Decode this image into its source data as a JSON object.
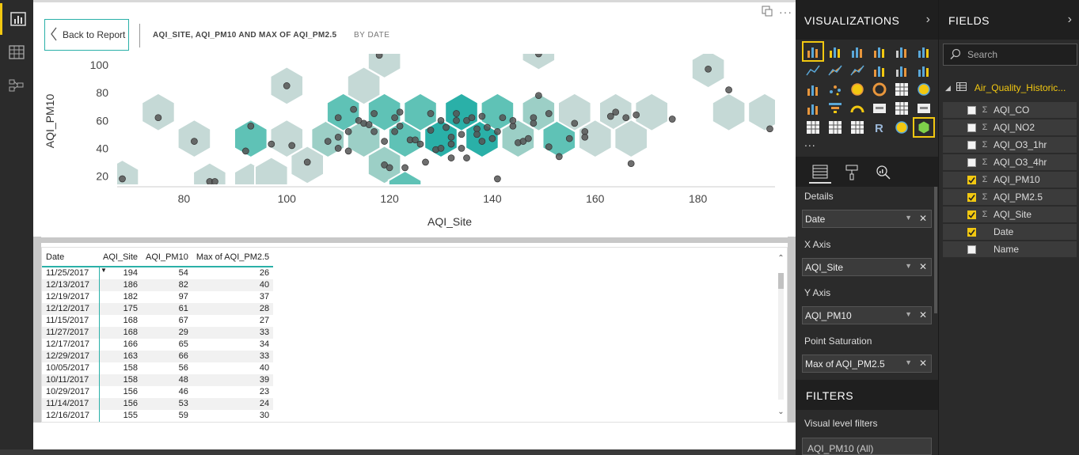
{
  "canvas": {
    "back_button": "Back to Report",
    "title": "AQI_SITE, AQI_PM10 AND MAX OF AQI_PM2.5",
    "subtitle": "BY DATE"
  },
  "chart_data": {
    "type": "scatter",
    "subtype": "hexbin",
    "xlabel": "AQI_Site",
    "ylabel": "AQI_PM10",
    "x_ticks": [
      "80",
      "100",
      "120",
      "140",
      "160",
      "180"
    ],
    "y_ticks": [
      "100",
      "80",
      "60",
      "40",
      "20"
    ],
    "xlim": [
      67,
      195
    ],
    "ylim": [
      14,
      108
    ],
    "hex_saturation_note": "hex color intensity = Max of AQI_PM2.5",
    "points": [
      [
        68,
        18
      ],
      [
        75,
        62
      ],
      [
        82,
        45
      ],
      [
        85,
        16
      ],
      [
        86,
        16
      ],
      [
        93,
        56
      ],
      [
        92,
        38
      ],
      [
        97,
        43
      ],
      [
        100,
        85
      ],
      [
        101,
        42
      ],
      [
        104,
        30
      ],
      [
        108,
        45
      ],
      [
        110,
        62
      ],
      [
        110,
        48
      ],
      [
        110,
        40
      ],
      [
        112,
        52
      ],
      [
        112,
        38
      ],
      [
        113,
        68
      ],
      [
        114,
        60
      ],
      [
        115,
        58
      ],
      [
        116,
        57
      ],
      [
        117,
        52
      ],
      [
        117,
        65
      ],
      [
        118,
        107
      ],
      [
        119,
        45
      ],
      [
        119,
        28
      ],
      [
        120,
        26
      ],
      [
        121,
        62
      ],
      [
        121,
        52
      ],
      [
        122,
        66
      ],
      [
        122,
        56
      ],
      [
        123,
        26
      ],
      [
        124,
        46
      ],
      [
        125,
        46
      ],
      [
        126,
        43
      ],
      [
        127,
        30
      ],
      [
        128,
        65
      ],
      [
        128,
        53
      ],
      [
        129,
        39
      ],
      [
        130,
        60
      ],
      [
        130,
        40
      ],
      [
        131,
        55
      ],
      [
        132,
        43
      ],
      [
        132,
        33
      ],
      [
        132,
        48
      ],
      [
        133,
        65
      ],
      [
        133,
        60
      ],
      [
        134,
        50
      ],
      [
        134,
        40
      ],
      [
        135,
        60
      ],
      [
        135,
        33
      ],
      [
        136,
        62
      ],
      [
        137,
        54
      ],
      [
        137,
        50
      ],
      [
        138,
        45
      ],
      [
        138,
        63
      ],
      [
        139,
        55
      ],
      [
        140,
        47
      ],
      [
        141,
        52
      ],
      [
        141,
        18
      ],
      [
        142,
        62
      ],
      [
        144,
        56
      ],
      [
        144,
        60
      ],
      [
        145,
        44
      ],
      [
        146,
        45
      ],
      [
        147,
        47
      ],
      [
        148,
        62
      ],
      [
        148,
        58
      ],
      [
        149,
        78
      ],
      [
        151,
        65
      ],
      [
        151,
        41
      ],
      [
        153,
        34
      ],
      [
        155,
        47
      ],
      [
        156,
        58
      ],
      [
        158,
        52
      ],
      [
        158,
        48
      ],
      [
        163,
        63
      ],
      [
        164,
        66
      ],
      [
        166,
        62
      ],
      [
        167,
        29
      ],
      [
        168,
        64
      ],
      [
        175,
        61
      ],
      [
        182,
        97
      ],
      [
        186,
        82
      ],
      [
        194,
        54
      ],
      [
        149,
        108
      ],
      [
        150,
        113
      ]
    ],
    "hexes": [
      {
        "x": 68,
        "y": 18,
        "level": 1
      },
      {
        "x": 75,
        "y": 66,
        "level": 1
      },
      {
        "x": 82,
        "y": 47,
        "level": 1
      },
      {
        "x": 85,
        "y": 16,
        "level": 1
      },
      {
        "x": 93,
        "y": 16,
        "level": 1
      },
      {
        "x": 93,
        "y": 47,
        "level": 3
      },
      {
        "x": 100,
        "y": 85,
        "level": 1
      },
      {
        "x": 100,
        "y": 47,
        "level": 1
      },
      {
        "x": 108,
        "y": 47,
        "level": 2
      },
      {
        "x": 104,
        "y": 28,
        "level": 1
      },
      {
        "x": 111,
        "y": 66,
        "level": 3
      },
      {
        "x": 115,
        "y": 47,
        "level": 2
      },
      {
        "x": 119,
        "y": 66,
        "level": 3
      },
      {
        "x": 119,
        "y": 28,
        "level": 2
      },
      {
        "x": 119,
        "y": 104,
        "level": 1
      },
      {
        "x": 115,
        "y": 85,
        "level": 1
      },
      {
        "x": 123,
        "y": 47,
        "level": 3
      },
      {
        "x": 126,
        "y": 66,
        "level": 3
      },
      {
        "x": 130,
        "y": 47,
        "level": 4
      },
      {
        "x": 134,
        "y": 66,
        "level": 4
      },
      {
        "x": 138,
        "y": 47,
        "level": 4
      },
      {
        "x": 141,
        "y": 66,
        "level": 3
      },
      {
        "x": 145,
        "y": 47,
        "level": 2
      },
      {
        "x": 149,
        "y": 66,
        "level": 2
      },
      {
        "x": 153,
        "y": 47,
        "level": 3
      },
      {
        "x": 156,
        "y": 66,
        "level": 1
      },
      {
        "x": 160,
        "y": 47,
        "level": 1
      },
      {
        "x": 164,
        "y": 66,
        "level": 1
      },
      {
        "x": 167,
        "y": 47,
        "level": 1
      },
      {
        "x": 171,
        "y": 66,
        "level": 1
      },
      {
        "x": 182,
        "y": 97,
        "level": 1
      },
      {
        "x": 186,
        "y": 66,
        "level": 1
      },
      {
        "x": 193,
        "y": 66,
        "level": 1
      },
      {
        "x": 149,
        "y": 110,
        "level": 1
      },
      {
        "x": 123,
        "y": 10,
        "level": 3
      },
      {
        "x": 97,
        "y": 20,
        "level": 1
      }
    ]
  },
  "table": {
    "columns": [
      "Date",
      "AQI_Site",
      "AQI_PM10",
      "Max of AQI_PM2.5"
    ],
    "sort_indicator": "▼",
    "rows": [
      [
        "11/25/2017",
        "194",
        "54",
        "26"
      ],
      [
        "12/13/2017",
        "186",
        "82",
        "40"
      ],
      [
        "12/19/2017",
        "182",
        "97",
        "37"
      ],
      [
        "12/12/2017",
        "175",
        "61",
        "28"
      ],
      [
        "11/15/2017",
        "168",
        "67",
        "27"
      ],
      [
        "11/27/2017",
        "168",
        "29",
        "33"
      ],
      [
        "12/17/2017",
        "166",
        "65",
        "34"
      ],
      [
        "12/29/2017",
        "163",
        "66",
        "33"
      ],
      [
        "10/05/2017",
        "158",
        "56",
        "40"
      ],
      [
        "10/11/2017",
        "158",
        "48",
        "39"
      ],
      [
        "10/29/2017",
        "156",
        "46",
        "23"
      ],
      [
        "11/14/2017",
        "156",
        "53",
        "24"
      ],
      [
        "12/16/2017",
        "155",
        "59",
        "30"
      ]
    ]
  },
  "visualizations": {
    "title": "VISUALIZATIONS",
    "more": "...",
    "wells": [
      {
        "label": "Details",
        "value": "Date"
      },
      {
        "label": "X Axis",
        "value": "AQI_Site"
      },
      {
        "label": "Y Axis",
        "value": "AQI_PM10"
      },
      {
        "label": "Point Saturation",
        "value": "Max of AQI_PM2.5"
      }
    ],
    "filters_title": "FILTERS",
    "visual_level_filters": "Visual level filters",
    "filter_item": "AQI_PM10 (All)"
  },
  "fields": {
    "title": "FIELDS",
    "search_placeholder": "Search",
    "table_name": "Air_Quality_Historic...",
    "items": [
      {
        "name": "AQI_CO",
        "checked": false,
        "sigma": true
      },
      {
        "name": "AQI_NO2",
        "checked": false,
        "sigma": true
      },
      {
        "name": "AQI_O3_1hr",
        "checked": false,
        "sigma": true
      },
      {
        "name": "AQI_O3_4hr",
        "checked": false,
        "sigma": true
      },
      {
        "name": "AQI_PM10",
        "checked": true,
        "sigma": true
      },
      {
        "name": "AQI_PM2.5",
        "checked": true,
        "sigma": true
      },
      {
        "name": "AQI_Site",
        "checked": true,
        "sigma": true
      },
      {
        "name": "Date",
        "checked": true,
        "sigma": false
      },
      {
        "name": "Name",
        "checked": false,
        "sigma": false
      }
    ]
  },
  "colors": {
    "accent": "#f2c811",
    "teal": "#2ab0a8",
    "hex_levels": [
      "#c5d9d6",
      "#9ccfc6",
      "#5fc2b6",
      "#2ab0a8"
    ]
  }
}
